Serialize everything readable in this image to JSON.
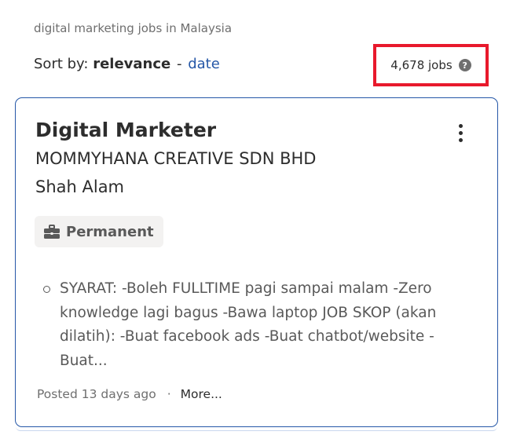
{
  "search_context": "digital marketing jobs in Malaysia",
  "sort": {
    "prefix": "Sort by:",
    "active": "relevance",
    "separator": "-",
    "alternative": "date"
  },
  "job_count": "4,678 jobs",
  "help_icon": {
    "icon": "question-circle-icon",
    "glyph": "?"
  },
  "job": {
    "title": "Digital Marketer",
    "company": "MOMMYHANA CREATIVE SDN BHD",
    "location": "Shah Alam",
    "job_type": "Permanent",
    "job_type_icon": "briefcase-icon",
    "snippet": "SYARAT: -Boleh FULLTIME pagi sampai malam -Zero knowledge lagi bagus -Bawa laptop JOB SKOP (akan dilatih): -Buat facebook ads -Buat chatbot/website -Buat...",
    "posted": "Posted 13 days ago",
    "footer_separator": "·",
    "more_label": "More..."
  },
  "colors": {
    "link": "#2557a7",
    "highlight_box": "#e8192c",
    "card_border": "#2557a7",
    "badge_bg": "#f3f2f1"
  }
}
